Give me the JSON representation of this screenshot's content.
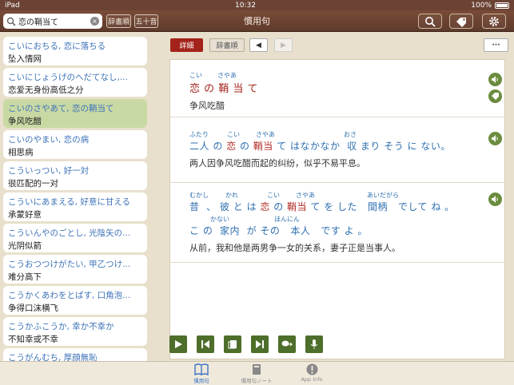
{
  "status": {
    "device": "iPad",
    "wifi": "wifi",
    "time": "10:32",
    "battery": "100%"
  },
  "nav": {
    "search_value": "恋の鞘当て",
    "btn_jisho": "辞書順",
    "btn_gojuon": "五十音",
    "title": "慣用句",
    "icons": [
      "search-icon",
      "tag-icon",
      "gear-icon"
    ]
  },
  "sidebar": {
    "items": [
      {
        "yomi": "こいにおちる, 恋に落ちる",
        "mean": "坠入情网",
        "selected": false
      },
      {
        "yomi": "こいにじょうげのへだてなし,...",
        "mean": "恋爱无身份高低之分",
        "selected": false
      },
      {
        "yomi": "こいのさやあて, 恋の鞘当て",
        "mean": "争风吃醋",
        "selected": true
      },
      {
        "yomi": "こいのやまい, 恋の病",
        "mean": "相思病",
        "selected": false
      },
      {
        "yomi": "こういっつい, 好一対",
        "mean": "很匹配的一对",
        "selected": false
      },
      {
        "yomi": "こういにあまえる, 好意に甘える",
        "mean": "承蒙好意",
        "selected": false
      },
      {
        "yomi": "こういんやのごとし, 光陰矢の...",
        "mean": "光阴似箭",
        "selected": false
      },
      {
        "yomi": "こうおつつけがたい, 甲乙つけ...",
        "mean": "难分高下",
        "selected": false
      },
      {
        "yomi": "こうかくあわをとばす, 口角泡...",
        "mean": "争得口沫横飞",
        "selected": false
      },
      {
        "yomi": "こうかふこうか, 幸か不幸か",
        "mean": "不知幸或不幸",
        "selected": false
      },
      {
        "yomi": "こうがんむち, 厚顔無恥",
        "mean": "",
        "selected": false
      }
    ]
  },
  "main": {
    "seg_detail": "詳細",
    "seg_jisho": "辞書順",
    "prev": "◀",
    "next": "▶",
    "more": "···",
    "headword": {
      "furigana": [
        {
          "t": "こい"
        },
        {
          "t": "さやあ"
        }
      ],
      "text": "恋 の 鞘 当 て",
      "translation": "争风吃醋"
    },
    "example1": {
      "furigana": [
        "ふたり",
        "こい",
        "さやあ",
        "おさ"
      ],
      "pre": "二人 の ",
      "red1": "恋",
      "mid": " の ",
      "red2": "鞘当",
      "post": " て はなかなか  収 まり そう に ない。",
      "translation": "两人因争风吃醋而起的纠纷，似乎不易平息。"
    },
    "example2": {
      "furigana1": [
        "むかし",
        "かれ",
        "こい",
        "さやあ",
        "あいだがら"
      ],
      "pre": "昔  、 彼 と は ",
      "red1": "恋",
      "mid": " の ",
      "red2": "鞘当",
      "post": " て を した   間柄   でして ね 。",
      "furigana2": [
        "かない",
        "ほんにん"
      ],
      "line2": "こ の  家内  が その   本人   です よ 。",
      "translation": "从前，我和他是两男争一女的关系，妻子正是当事人。"
    }
  },
  "tabs": [
    {
      "label": "慣用句",
      "icon": "book-icon",
      "active": true
    },
    {
      "label": "慣用句ノート",
      "icon": "notebook-icon",
      "active": false
    },
    {
      "label": "App Info",
      "icon": "info-icon",
      "active": false
    }
  ],
  "colors": {
    "nav_brown": "#6b4233",
    "accent_red": "#a3231b",
    "link_blue": "#3d73b8",
    "toolbar_green": "#4e6e2b",
    "selected_green": "#c9d9a4"
  }
}
